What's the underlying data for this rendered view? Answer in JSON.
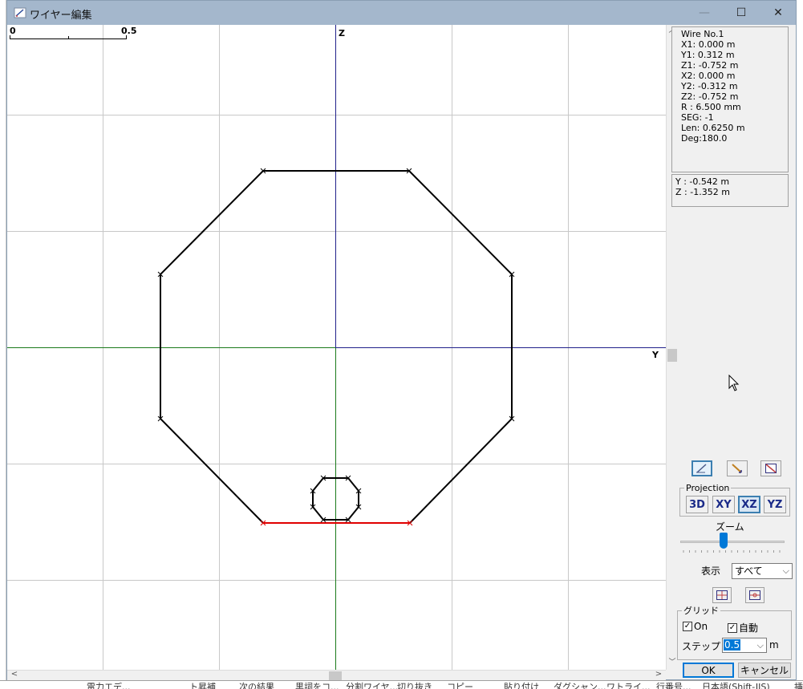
{
  "window": {
    "title": "ワイヤー編集",
    "minimize": "—",
    "maximize": "☐",
    "close": "✕"
  },
  "canvas": {
    "scale_left": "0",
    "scale_right": "0.5",
    "axis_z": "Z",
    "axis_y": "Y",
    "wire_color": "#000000",
    "selected_wire_color": "#e00000",
    "grid_color": "#c8c8c8",
    "h_axis_color": "#1a7a1a",
    "v_axis_color": "#20208a"
  },
  "wire_info": {
    "lines": [
      "Wire No.1",
      "X1: 0.000 m",
      "Y1: 0.312 m",
      "Z1: -0.752 m",
      "X2: 0.000 m",
      "Y2: -0.312 m",
      "Z2: -0.752 m",
      "R : 6.500 mm",
      "SEG: -1",
      "Len: 0.6250 m",
      "Deg:180.0"
    ]
  },
  "cursor_coords": {
    "y": "Y : -0.542 m",
    "z": "Z : -1.352 m"
  },
  "tools": {
    "pen": "pen-icon",
    "stretch": "stretch-icon",
    "rect": "rect-icon"
  },
  "projection": {
    "legend": "Projection",
    "buttons": [
      "3D",
      "XY",
      "XZ",
      "YZ"
    ],
    "active": "XZ"
  },
  "zoom": {
    "label": "ズーム",
    "level": 0.45
  },
  "display": {
    "label": "表示",
    "value": "すべて"
  },
  "grid": {
    "legend": "グリッド",
    "on_label": "On",
    "auto_label": "自動",
    "step_label": "ステップ",
    "step_value": "0.5",
    "unit": "m"
  },
  "actions": {
    "ok": "OK",
    "cancel": "キャンセル"
  },
  "background": {
    "taskbar_items": [
      "電力エデ...",
      "ト昇補",
      "次の結果",
      "黒詞をコ...",
      "分割ワイヤ...",
      "切り抜き",
      "コピー",
      "貼り付け",
      "ダグシャン...",
      "ワトライ...",
      "行番号...",
      "日本語(Shift-JIS)",
      "挿"
    ]
  }
}
